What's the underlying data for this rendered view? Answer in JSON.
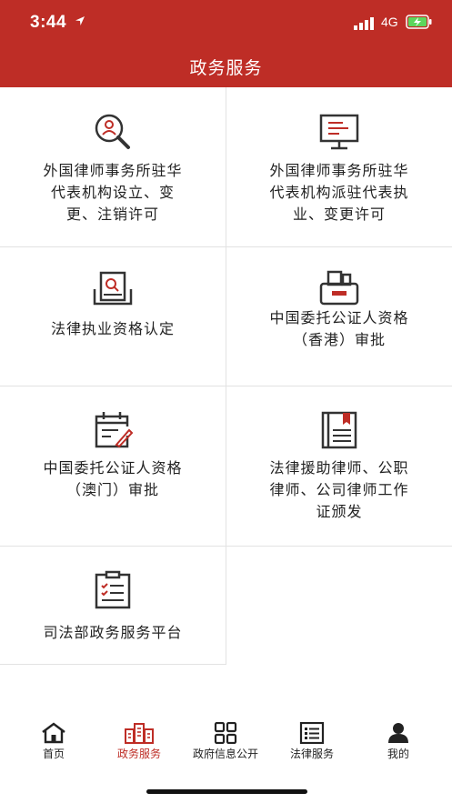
{
  "status_bar": {
    "time": "3:44",
    "network": "4G"
  },
  "header": {
    "title": "政务服务"
  },
  "services": [
    {
      "icon": "search-person-icon",
      "lines": [
        "外国律师事务所驻华",
        "代表机构设立、变",
        "更、注销许可"
      ]
    },
    {
      "icon": "monitor-icon",
      "lines": [
        "外国律师事务所驻华",
        "代表机构派驻代表执",
        "业、变更许可"
      ]
    },
    {
      "icon": "document-search-icon",
      "lines": [
        "法律执业资格认定"
      ]
    },
    {
      "icon": "printer-icon",
      "lines": [
        "中国委托公证人资格",
        "（香港）审批"
      ]
    },
    {
      "icon": "calendar-pen-icon",
      "lines": [
        "中国委托公证人资格",
        "（澳门）审批"
      ]
    },
    {
      "icon": "book-bookmark-icon",
      "lines": [
        "法律援助律师、公职",
        "律师、公司律师工作",
        "证颁发"
      ]
    },
    {
      "icon": "clipboard-checklist-icon",
      "lines": [
        "司法部政务服务平台"
      ]
    }
  ],
  "tabbar": [
    {
      "label": "首页",
      "icon": "home-icon",
      "active": false
    },
    {
      "label": "政务服务",
      "icon": "building-icon",
      "active": true
    },
    {
      "label": "政府信息公开",
      "icon": "grid-icon",
      "active": false
    },
    {
      "label": "法律服务",
      "icon": "list-icon",
      "active": false
    },
    {
      "label": "我的",
      "icon": "user-icon",
      "active": false
    }
  ],
  "colors": {
    "brand": "#be2d26",
    "active_tab": "#be2d26",
    "text": "#222222",
    "divider": "#e2e2e2"
  }
}
